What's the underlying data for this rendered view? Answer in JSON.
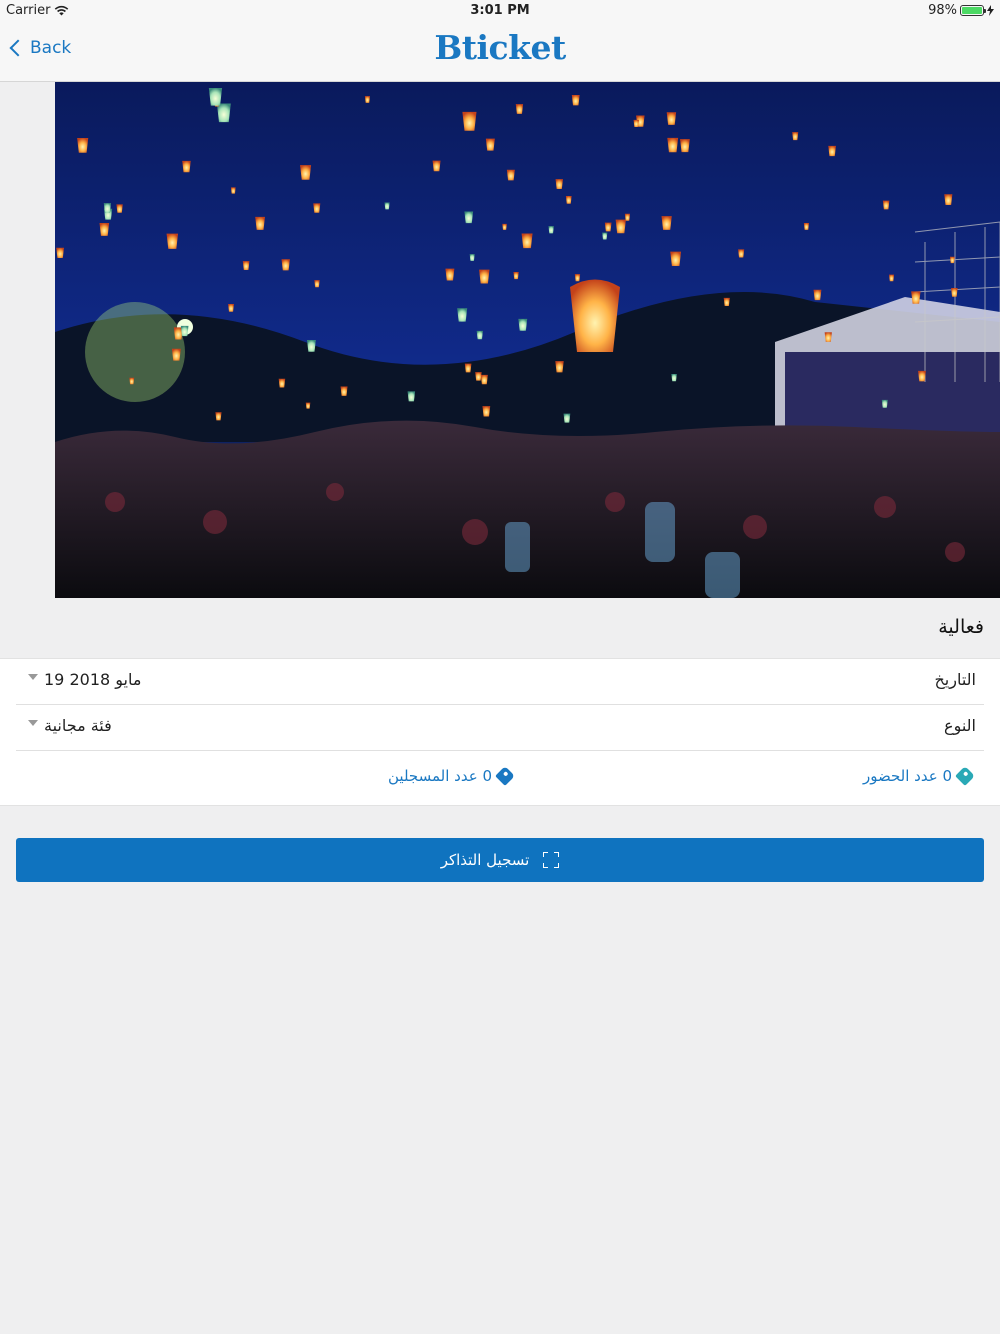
{
  "status_bar": {
    "carrier": "Carrier",
    "time": "3:01 PM",
    "battery": "98%",
    "battery_level": 0.98
  },
  "nav": {
    "back_label": "Back",
    "brand": "Bticket"
  },
  "event": {
    "title": "فعالية",
    "date_label": "التاريخ",
    "date_value": "19 مايو 2018",
    "type_label": "النوع",
    "type_value": "فئة مجانية",
    "attendance_count": "0 عدد الحضور",
    "registered_count": "0 عدد المسجلين"
  },
  "actions": {
    "register_label": "تسجيل التذاكر"
  },
  "colors": {
    "accent": "#1a78c2",
    "button": "#0f73bf",
    "teal": "#2aa9b6"
  }
}
